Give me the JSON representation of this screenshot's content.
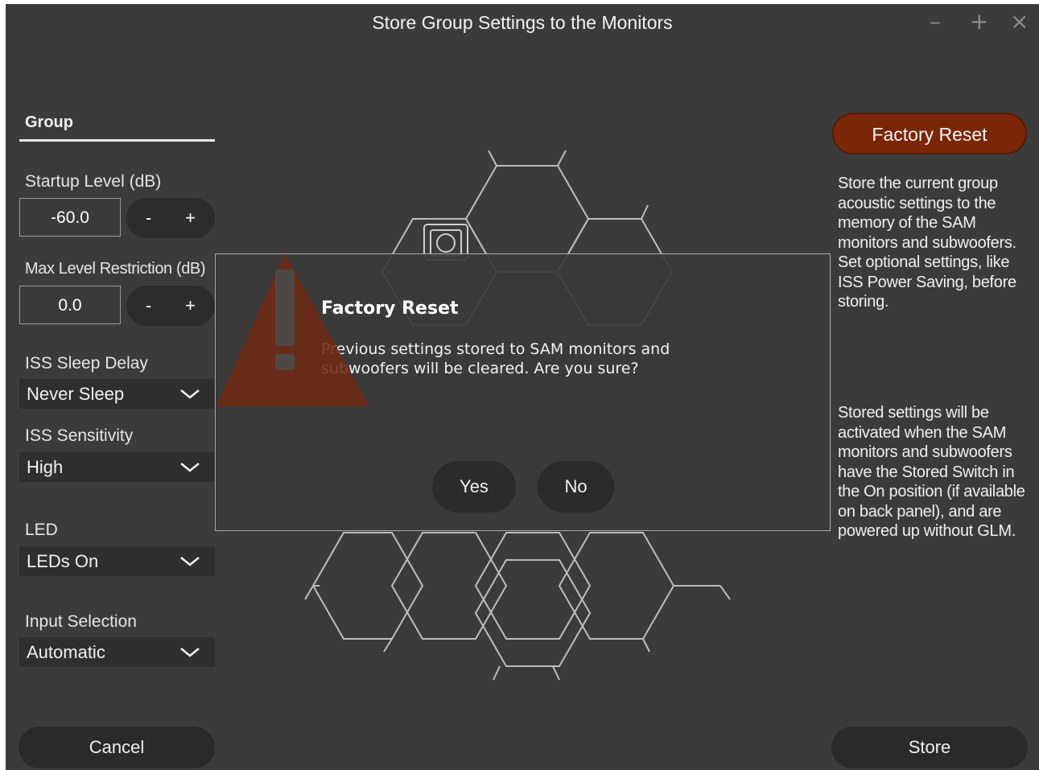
{
  "window": {
    "title": "Store Group Settings to the Monitors",
    "controls": {
      "minimize": "–",
      "maximize": "+",
      "close": "×"
    }
  },
  "left_panel": {
    "tab": "Group",
    "startup_level": {
      "label": "Startup Level (dB)",
      "value": "-60.0",
      "minus": "-",
      "plus": "+"
    },
    "max_level": {
      "label": "Max Level Restriction (dB)",
      "value": "0.0",
      "minus": "-",
      "plus": "+"
    },
    "iss_sleep_delay": {
      "label": "ISS Sleep Delay",
      "value": "Never Sleep"
    },
    "iss_sensitivity": {
      "label": "ISS Sensitivity",
      "value": "High"
    },
    "led": {
      "label": "LED",
      "value": "LEDs On"
    },
    "input_selection": {
      "label": "Input Selection",
      "value": "Automatic"
    },
    "cancel": "Cancel"
  },
  "right_panel": {
    "factory_reset": "Factory Reset",
    "description_1": "Store the current group acoustic settings to the memory of the SAM monitors and subwoofers. Set optional settings, like ISS Power Saving, before storing.",
    "description_2": "Stored settings will be activated when the SAM monitors and subwoofers have the Stored Switch in the On position (if available on back panel), and are powered up without GLM.",
    "store": "Store"
  },
  "dialog": {
    "title": "Factory Reset",
    "message": "Previous settings stored to SAM monitors and subwoofers will be cleared. Are you sure?",
    "yes": "Yes",
    "no": "No",
    "icon": "warning-icon"
  },
  "colors": {
    "background": "#3b3b3b",
    "accent_danger": "#7a2609",
    "warning_icon": "#6e2a14"
  }
}
